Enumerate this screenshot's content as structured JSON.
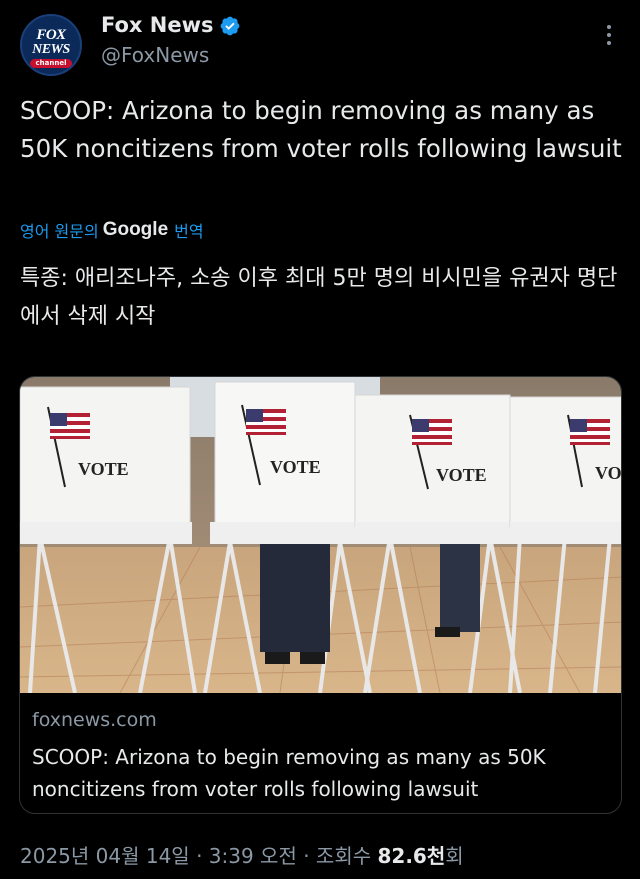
{
  "account": {
    "logo_line1": "FOX",
    "logo_line2": "NEWS",
    "logo_line3": "channel",
    "name": "Fox News",
    "handle": "@FoxNews",
    "verified_icon": "verified-badge-icon",
    "verified_color": "#1d9bf0"
  },
  "tweet": {
    "text": "SCOOP: Arizona to begin removing as many as 50K noncitizens from voter rolls following lawsuit",
    "translate_prefix": "영어 원문의",
    "translate_provider": "Google",
    "translate_suffix": "번역",
    "translated_text": "특종: 애리조나주, 소송 이후 최대 5만 명의 비시민을 유권자 명단에서 삭제 시작"
  },
  "card": {
    "domain": "foxnews.com",
    "title": "SCOOP: Arizona to begin removing as many as 50K noncitizens from voter rolls following lawsuit",
    "booth_label": "VOTE"
  },
  "meta": {
    "date": "2025년 04월 14일 · 3:39 오전 · 조회수",
    "views": "82.6천",
    "views_suffix": "회"
  },
  "colors": {
    "background": "#000000",
    "text": "#e7e9ea",
    "secondary": "#8b98a5",
    "link": "#1d9bf0",
    "border": "#2f3336"
  }
}
